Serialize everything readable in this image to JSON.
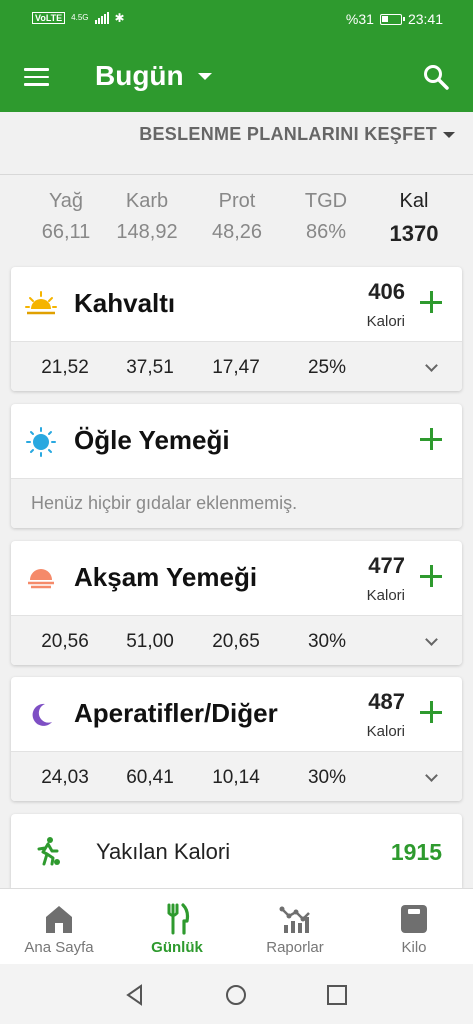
{
  "status_bar": {
    "volte": "VoLTE",
    "network": "4.5G",
    "battery_percent": "%31",
    "battery_level": 0.31,
    "time": "23:41"
  },
  "app_bar": {
    "title": "Bugün",
    "menu_icon": "hamburger-menu-icon",
    "search_icon": "search-icon"
  },
  "explore": {
    "label": "BESLENME PLANLARINI KEŞFET"
  },
  "summary": {
    "fat": {
      "label": "Yağ",
      "value": "66,11"
    },
    "carb": {
      "label": "Karb",
      "value": "148,92"
    },
    "prot": {
      "label": "Prot",
      "value": "48,26"
    },
    "tgd": {
      "label": "TGD",
      "value": "86%"
    },
    "kal": {
      "label": "Kal",
      "value": "1370"
    }
  },
  "meals": [
    {
      "name": "Kahvaltı",
      "icon": "sunrise-icon",
      "calories": "406",
      "unit": "Kalori",
      "fat": "21,52",
      "carb": "37,51",
      "prot": "17,47",
      "tgd": "25%"
    },
    {
      "name": "Öğle Yemeği",
      "icon": "sun-icon",
      "empty_text": "Henüz hiçbir gıdalar eklenmemiş."
    },
    {
      "name": "Akşam Yemeği",
      "icon": "sunset-icon",
      "calories": "477",
      "unit": "Kalori",
      "fat": "20,56",
      "carb": "51,00",
      "prot": "20,65",
      "tgd": "30%"
    },
    {
      "name": "Aperatifler/Diğer",
      "icon": "moon-icon",
      "calories": "487",
      "unit": "Kalori",
      "fat": "24,03",
      "carb": "60,41",
      "prot": "10,14",
      "tgd": "30%"
    }
  ],
  "burned": {
    "label": "Yakılan Kalori",
    "value": "1915",
    "icon": "running-icon"
  },
  "bottom_nav": [
    {
      "label": "Ana Sayfa",
      "icon": "home-icon"
    },
    {
      "label": "Günlük",
      "icon": "cutlery-icon",
      "active": true
    },
    {
      "label": "Raporlar",
      "icon": "reports-icon"
    },
    {
      "label": "Kilo",
      "icon": "scale-icon"
    }
  ],
  "colors": {
    "primary": "#2e9a2e",
    "background": "#f1f1f1",
    "card": "#ffffff"
  }
}
